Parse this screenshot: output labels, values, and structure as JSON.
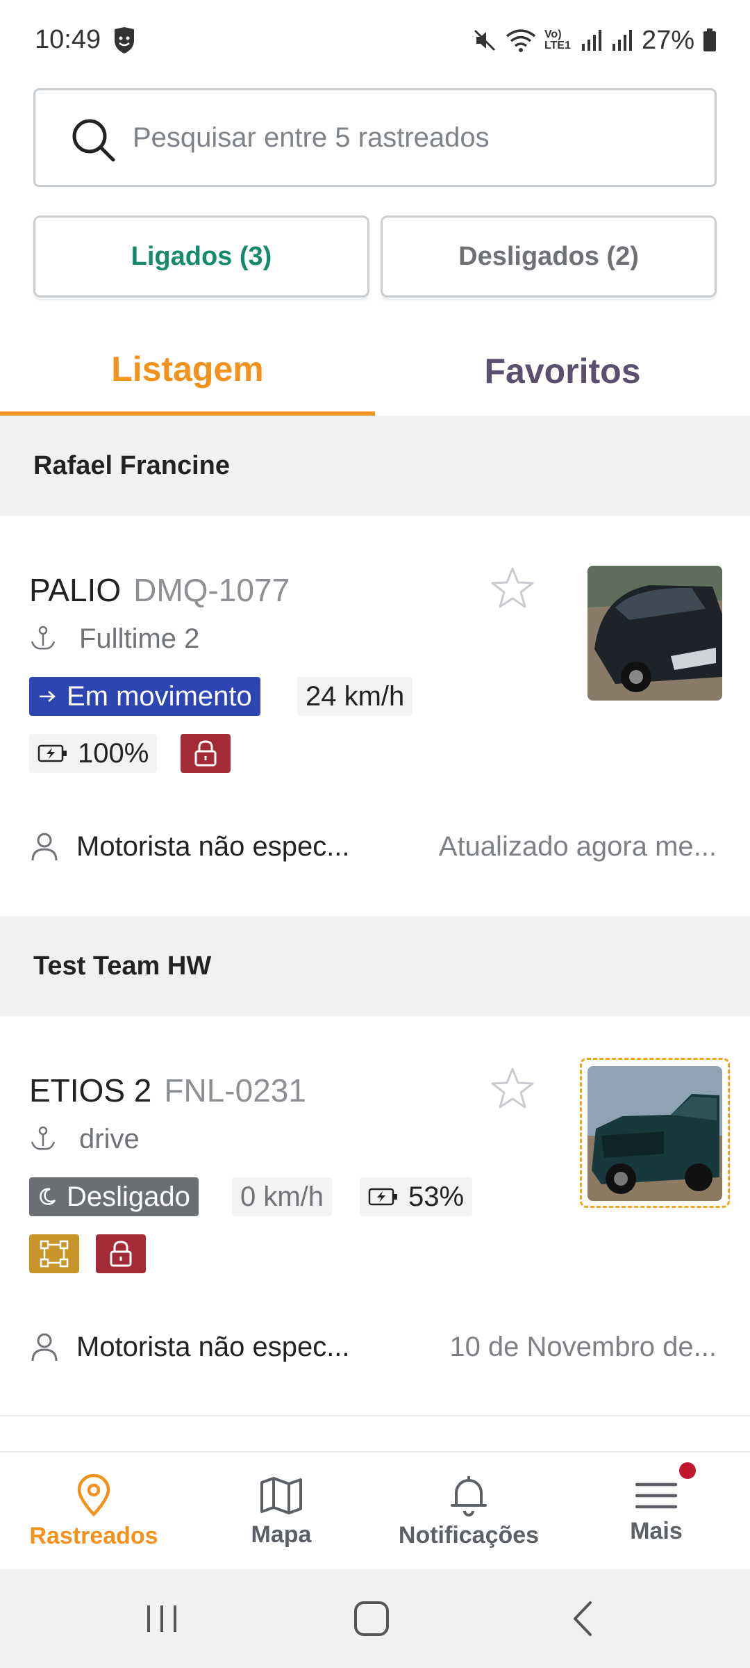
{
  "status_bar": {
    "time": "10:49",
    "battery": "27%",
    "network": "Vo) LTE1"
  },
  "search": {
    "placeholder": "Pesquisar entre 5 rastreados",
    "value": ""
  },
  "filters": {
    "on_label": "Ligados (3)",
    "off_label": "Desligados (2)"
  },
  "tabs": {
    "list_label": "Listagem",
    "favorites_label": "Favoritos"
  },
  "groups": [
    {
      "name": "Rafael Francine",
      "vehicle": {
        "name": "PALIO",
        "plate": "DMQ-1077",
        "device": "Fulltime 2",
        "status": "Em movimento",
        "speed": "24 km/h",
        "battery": "100%",
        "driver": "Motorista não espec...",
        "updated": "Atualizado agora me..."
      }
    },
    {
      "name": "Test Team HW",
      "vehicle": {
        "name": "ETIOS 2",
        "plate": "FNL-0231",
        "device": "drive",
        "status": "Desligado",
        "speed": "0 km/h",
        "battery": "53%",
        "driver": "Motorista não espec...",
        "updated": "10 de Novembro de..."
      }
    }
  ],
  "bottom_nav": [
    {
      "label": "Rastreados"
    },
    {
      "label": "Mapa"
    },
    {
      "label": "Notificações"
    },
    {
      "label": "Mais"
    }
  ],
  "colors": {
    "accent": "#f2911b",
    "on_green": "#158a6b",
    "moving_blue": "#2e46b2",
    "lock_red": "#a32a37",
    "fence_gold": "#c8952a"
  }
}
